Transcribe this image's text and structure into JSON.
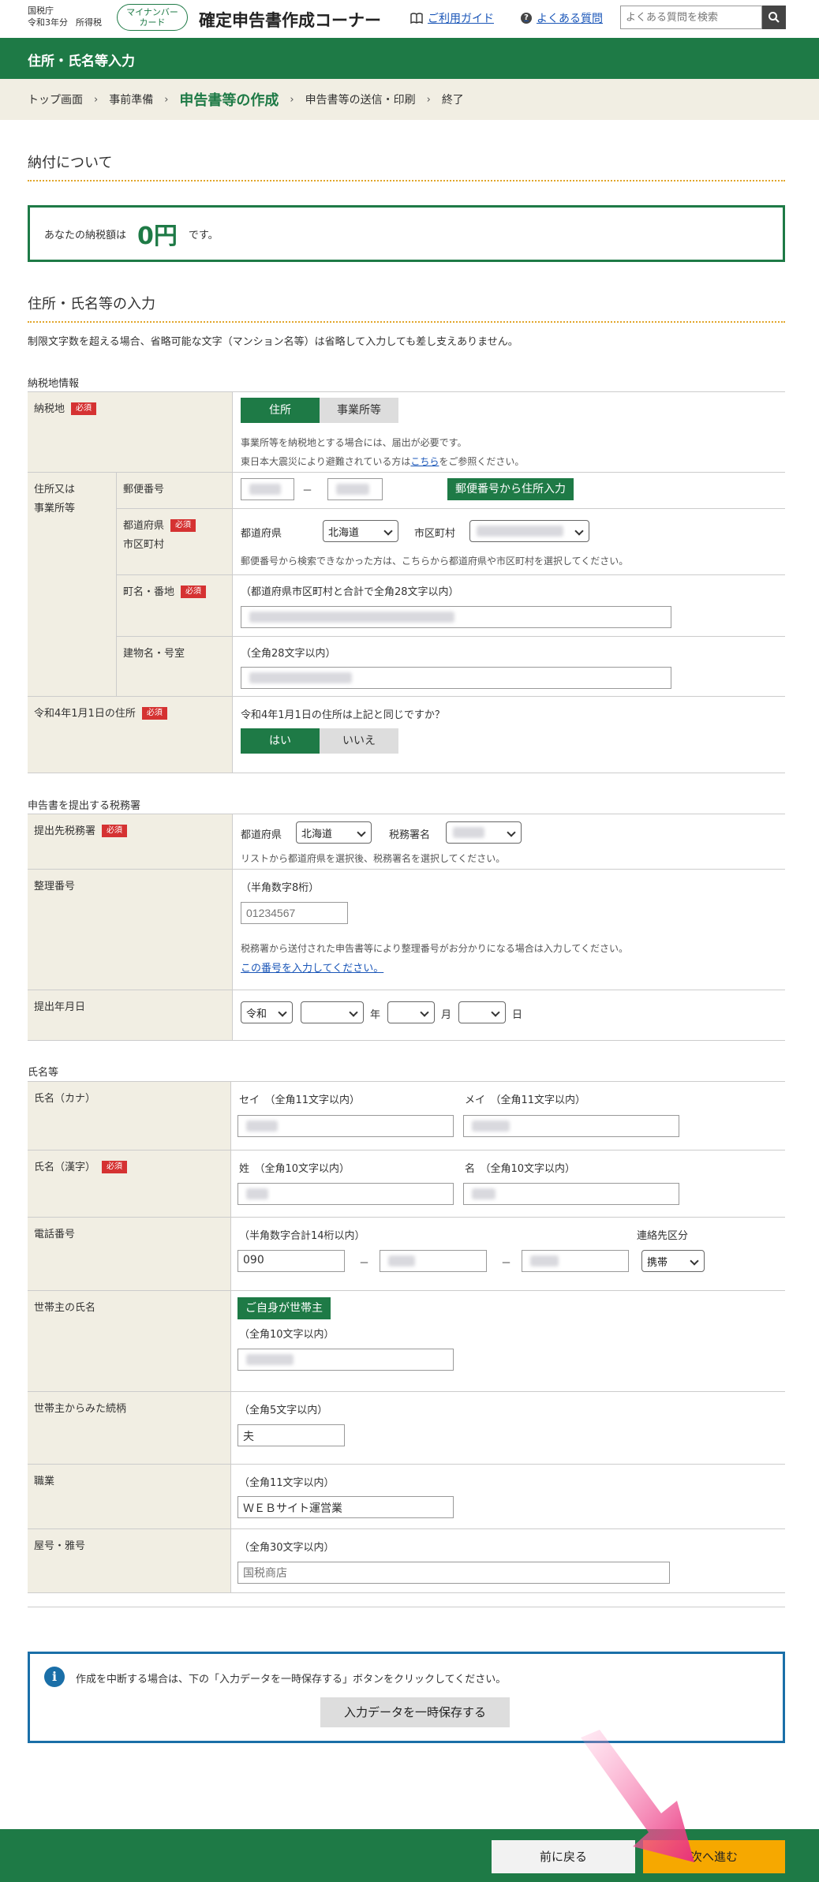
{
  "header": {
    "agency": "国税庁",
    "year": "令和3年分",
    "tax_type": "所得税",
    "mynumber_card": [
      "マイナンバー",
      "カード"
    ],
    "app_title": "確定申告書作成コーナー",
    "guide_link": "ご利用ガイド",
    "faq_link": "よくある質問",
    "search_placeholder": "よくある質問を検索"
  },
  "page_heading": "住所・氏名等入力",
  "breadcrumb": [
    "トップ画面",
    "事前準備",
    "申告書等の作成",
    "申告書等の送信・印刷",
    "終了"
  ],
  "payment": {
    "title": "納付について",
    "prefix": "あなたの納税額は",
    "amount": "0円",
    "suffix": "です。"
  },
  "address_section": {
    "title": "住所・氏名等の入力",
    "note": "制限文字数を超える場合、省略可能な文字（マンション名等）は省略して入力しても差し支えありません。"
  },
  "required_label": "必須",
  "tax_place": {
    "group_label": "納税地情報",
    "nozeichi_label": "納税地",
    "toggle_address": "住所",
    "toggle_office": "事業所等",
    "note1": "事業所等を納税地とする場合には、届出が必要です。",
    "note2_prefix": "東日本大震災により避難されている方は",
    "note2_link": "こちら",
    "note2_suffix": "をご参照ください。",
    "address_or_office": [
      "住所又は",
      "事業所等"
    ],
    "postal_label": "郵便番号",
    "postal_dash": "－",
    "postal_button": "郵便番号から住所入力",
    "pref_city_label": [
      "都道府県",
      "市区町村"
    ],
    "pref_label": "都道府県",
    "pref_value": "北海道",
    "city_label": "市区町村",
    "pref_note": "郵便番号から検索できなかった方は、こちらから都道府県や市区町村を選択してください。",
    "town_label": "町名・番地",
    "town_hint": "（都道府県市区町村と合計で全角28文字以内）",
    "building_label": "建物名・号室",
    "building_hint": "（全角28文字以内）",
    "jan1_label": "令和4年1月1日の住所",
    "jan1_question": "令和4年1月1日の住所は上記と同じですか？",
    "yes": "はい",
    "no": "いいえ"
  },
  "tax_office": {
    "group_label": "申告書を提出する税務署",
    "office_label": "提出先税務署",
    "pref_label": "都道府県",
    "pref_value": "北海道",
    "office_name_label": "税務署名",
    "note": "リストから都道府県を選択後、税務署名を選択してください。",
    "ref_label": "整理番号",
    "ref_hint": "（半角数字8桁）",
    "ref_placeholder": "01234567",
    "ref_note": "税務署から送付された申告書等により整理番号がお分かりになる場合は入力してください。",
    "ref_link": "この番号を入力してください。",
    "date_label": "提出年月日",
    "era_value": "令和",
    "year_unit": "年",
    "month_unit": "月",
    "day_unit": "日"
  },
  "name_section": {
    "group_label": "氏名等",
    "kana_label": "氏名（カナ）",
    "sei_hint": "セイ　（全角11文字以内）",
    "mei_hint": "メイ　（全角11文字以内）",
    "kanji_label": "氏名（漢字）",
    "sei_kanji_hint": "姓　（全角10文字以内）",
    "mei_kanji_hint": "名　（全角10文字以内）",
    "phone_label": "電話番号",
    "phone_hint": "（半角数字合計14桁以内）",
    "phone_type_label": "連絡先区分",
    "phone_part1": "090",
    "phone_dash": "－",
    "phone_type_value": "携帯",
    "head_label": "世帯主の氏名",
    "head_button": "ご自身が世帯主",
    "head_hint": "（全角10文字以内）",
    "relation_label": "世帯主からみた続柄",
    "relation_hint": "（全角5文字以内）",
    "relation_value": "夫",
    "job_label": "職業",
    "job_hint": "（全角11文字以内）",
    "job_value": "ＷＥＢサイト運営業",
    "trade_label": "屋号・雅号",
    "trade_hint": "（全角30文字以内）",
    "trade_placeholder": "国税商店"
  },
  "info": {
    "icon": "i",
    "text": "作成を中断する場合は、下の「入力データを一時保存する」ボタンをクリックしてください。",
    "save_button": "入力データを一時保存する"
  },
  "footer": {
    "back": "前に戻る",
    "next": "次へ進む"
  },
  "colors": {
    "brand_green": "#1e7a46",
    "label_bg": "#f1eee3",
    "required_red": "#d53232",
    "next_orange": "#f6a800",
    "info_blue": "#1a6fa8"
  }
}
